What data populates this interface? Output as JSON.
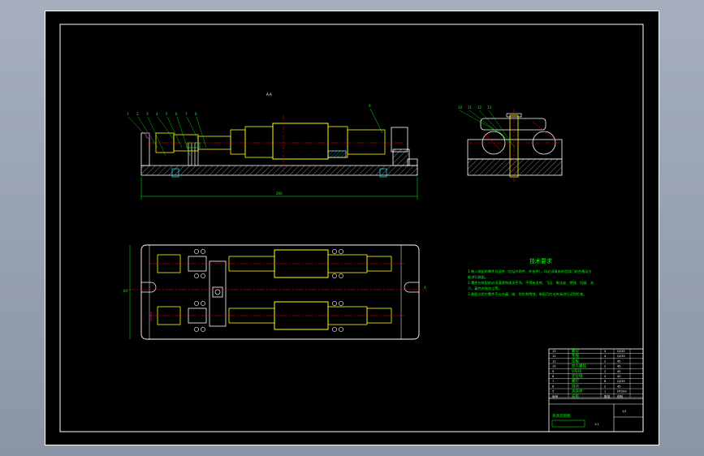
{
  "colors": {
    "background": "#000000",
    "frame": "#ffffff",
    "outline": "#ffffff",
    "centerline": "#ff0000",
    "part": "#ffff00",
    "dimension": "#00ff00",
    "hatch": "#00ffff",
    "accent": "#ff00ff"
  },
  "front_view": {
    "section_label": "A-A",
    "balloons": [
      "1",
      "2",
      "3",
      "4",
      "5",
      "6",
      "7",
      "8"
    ],
    "right_balloon": "9",
    "overall_dimension": "260"
  },
  "side_view": {
    "balloons": [
      "10",
      "11",
      "12",
      "13"
    ]
  },
  "top_view": {
    "left_dimension": "84",
    "right_mark": "A"
  },
  "technical_requirements": {
    "title": "技术要求",
    "lines": [
      "1.装入装配的零件及部件（包括外购件、外协件），均必须具有检验部门的合格证方",
      "能进行装配。",
      "2.零件在装配前必须清理和清洗干净，不得有毛刺、飞边、氧化皮、锈蚀、切屑、油",
      "污、着色剂和灰尘等。",
      "3.装配过程中零件不允许磕、碰、划伤和锈蚀，装配后应对夹具进行试验检查。"
    ]
  },
  "title_block": {
    "rows": [
      [
        "13",
        "螺母",
        "4",
        "Q235"
      ],
      [
        "12",
        "垫圈",
        "4",
        "Q235"
      ],
      [
        "11",
        "压板",
        "2",
        "45"
      ],
      [
        "10",
        "双头螺柱",
        "2",
        "45"
      ],
      [
        "9",
        "V形块",
        "2",
        "45"
      ],
      [
        "8",
        "定位销",
        "4",
        "45"
      ],
      [
        "7",
        "螺钉",
        "8",
        "Q235"
      ],
      [
        "6",
        "挡块",
        "2",
        "45"
      ],
      [
        "5",
        "夹具体",
        "1",
        "HT200"
      ]
    ],
    "header": [
      "序号",
      "名称",
      "数量",
      "材料"
    ],
    "drawing_name": "夹具装配图",
    "scale": "1:1",
    "sheet": "1/1"
  }
}
